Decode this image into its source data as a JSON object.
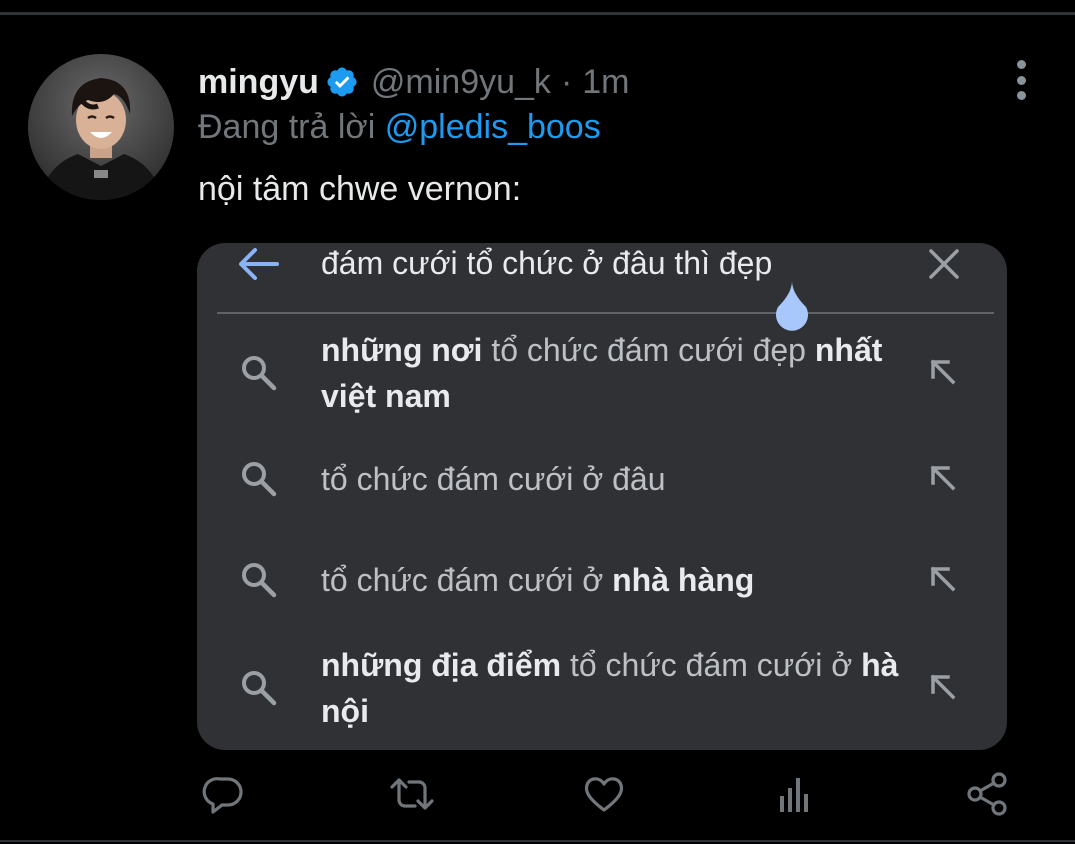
{
  "tweet": {
    "author": {
      "display_name": "mingyu",
      "handle": "@min9yu_k",
      "separator": "·",
      "time": "1m",
      "verified_icon": "verified-badge-icon"
    },
    "reply_prefix": "Đang trả lời",
    "reply_to": "@pledis_boos",
    "text": "nội tâm chwe vernon:"
  },
  "media": {
    "query": "đám cưới tổ chức ở đâu thì đẹp",
    "suggestions": [
      {
        "parts": [
          {
            "t": "những nơi",
            "b": true
          },
          {
            "t": " tổ chức đám cưới đẹp ",
            "b": false
          },
          {
            "t": "nhất việt nam",
            "b": true
          }
        ]
      },
      {
        "parts": [
          {
            "t": "tổ chức đám cưới ở đâu",
            "b": false
          }
        ]
      },
      {
        "parts": [
          {
            "t": "tổ chức đám cưới ở ",
            "b": false
          },
          {
            "t": "nhà hàng",
            "b": true
          }
        ]
      },
      {
        "parts": [
          {
            "t": "những địa điểm",
            "b": true
          },
          {
            "t": " tổ chức đám cưới ở ",
            "b": false
          },
          {
            "t": "hà nội",
            "b": true
          }
        ]
      }
    ]
  },
  "actions": [
    "reply-icon",
    "retweet-icon",
    "like-icon",
    "analytics-icon",
    "share-icon"
  ],
  "colors": {
    "background": "#000000",
    "link": "#1d9bf0",
    "muted": "#71767b",
    "panel": "#303134",
    "accent_blue": "#8ab4f8"
  }
}
